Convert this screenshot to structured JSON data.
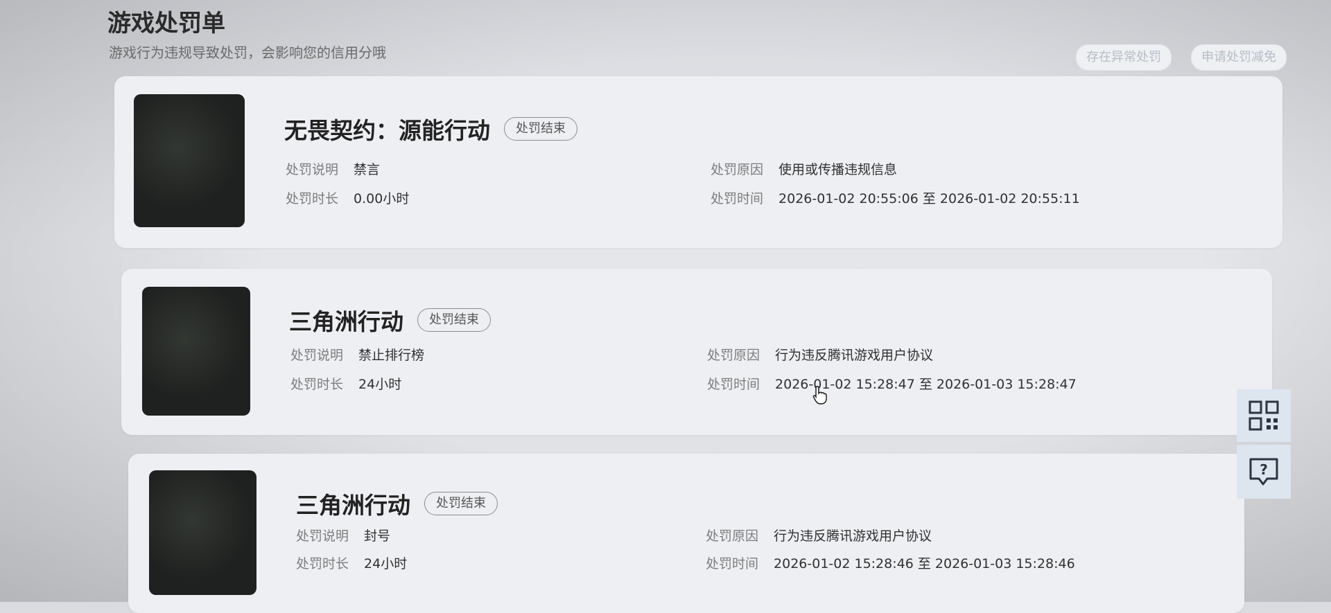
{
  "header": {
    "title": "游戏处罚单",
    "subtitle": "游戏行为违规导致处罚，会影响您的信用分哦",
    "actions": [
      "存在异常处罚",
      "申请处罚减免"
    ]
  },
  "records": [
    {
      "game": "无畏契约：源能行动",
      "status": "处罚结束",
      "desc_label": "处罚说明",
      "desc": "禁言",
      "duration_label": "处罚时长",
      "duration": "0.00小时",
      "reason_label": "处罚原因",
      "reason": "使用或传播违规信息",
      "time_label": "处罚时间",
      "time": "2026-01-02 20:55:06 至 2026-01-02 20:55:11"
    },
    {
      "game": "三角洲行动",
      "status": "处罚结束",
      "desc_label": "处罚说明",
      "desc": "禁止排行榜",
      "duration_label": "处罚时长",
      "duration": "24小时",
      "reason_label": "处罚原因",
      "reason": "行为违反腾讯游戏用户协议",
      "time_label": "处罚时间",
      "time": "2026-01-02 15:28:47 至 2026-01-03 15:28:47"
    },
    {
      "game": "三角洲行动",
      "status": "处罚结束",
      "desc_label": "处罚说明",
      "desc": "封号",
      "duration_label": "处罚时长",
      "duration": "24小时",
      "reason_label": "处罚原因",
      "reason": "行为违反腾讯游戏用户协议",
      "time_label": "处罚时间",
      "time": "2026-01-02 15:28:46 至 2026-01-03 15:28:46"
    }
  ],
  "side_tools": [
    "qr-code-icon",
    "help-chat-icon"
  ]
}
